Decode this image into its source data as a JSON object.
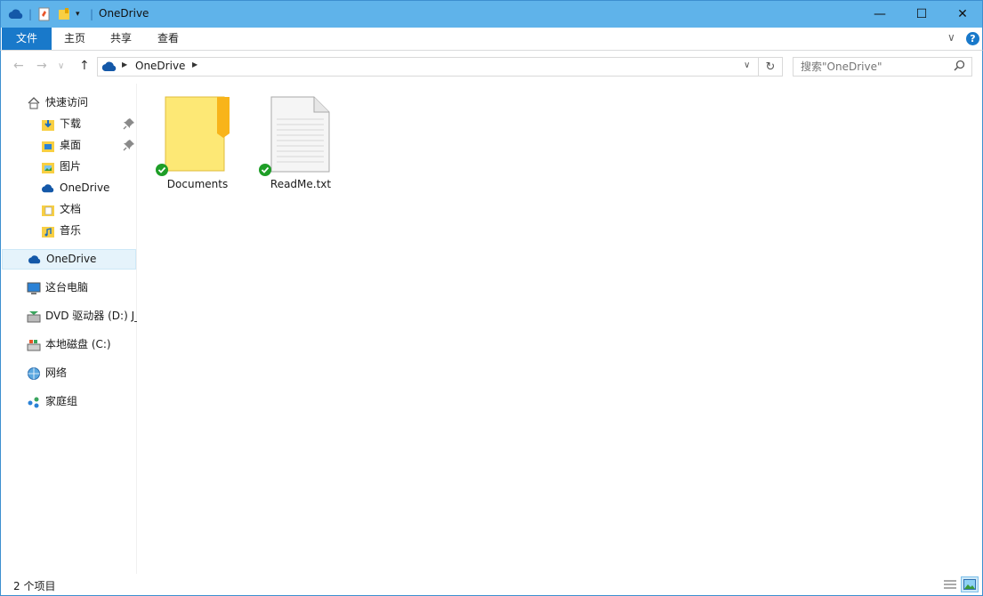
{
  "window": {
    "title": "OneDrive",
    "minimize_glyph": "—",
    "maximize_glyph": "☐",
    "close_glyph": "✕"
  },
  "ribbon": {
    "tabs": [
      {
        "label": "文件"
      },
      {
        "label": "主页"
      },
      {
        "label": "共享"
      },
      {
        "label": "查看"
      }
    ],
    "collapse_glyph": "∨",
    "help_glyph": "?"
  },
  "navigation": {
    "back_glyph": "←",
    "forward_glyph": "→",
    "recent_glyph": "∨",
    "up_glyph": "↑"
  },
  "address": {
    "path": "OneDrive",
    "refresh_glyph": "↻"
  },
  "search": {
    "placeholder": "搜索\"OneDrive\""
  },
  "sidebar": {
    "quick_access": "快速访问",
    "items": [
      {
        "label": "下载"
      },
      {
        "label": "桌面"
      },
      {
        "label": "图片"
      },
      {
        "label": "OneDrive"
      },
      {
        "label": "文档"
      },
      {
        "label": "音乐"
      }
    ],
    "onedrive": "OneDrive",
    "this_pc": "这台电脑",
    "dvd": "DVD 驱动器 (D:) J_",
    "local_disk": "本地磁盘 (C:)",
    "network": "网络",
    "homegroup": "家庭组"
  },
  "files": [
    {
      "name": "Documents"
    },
    {
      "name": "ReadMe.txt"
    }
  ],
  "status": {
    "item_count": "2 个项目"
  },
  "colors": {
    "accent": "#1979ca",
    "titlebar": "#5fb3ea",
    "folder": "#fde875",
    "sync_ok": "#1e9e27"
  }
}
